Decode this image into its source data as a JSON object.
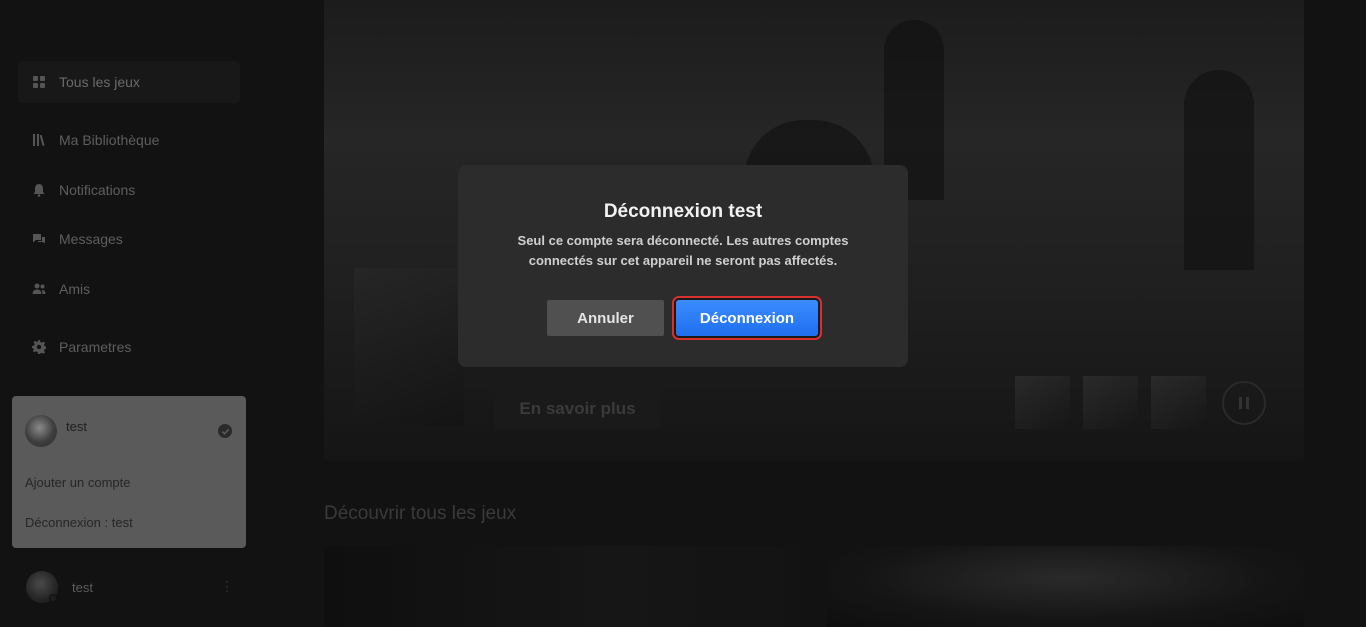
{
  "sidebar": {
    "items": [
      {
        "label": "Tous les jeux",
        "icon": "grid-icon"
      },
      {
        "label": "Ma Bibliothèque",
        "icon": "library-icon"
      },
      {
        "label": "Notifications",
        "icon": "bell-icon"
      },
      {
        "label": "Messages",
        "icon": "chat-icon"
      },
      {
        "label": "Amis",
        "icon": "friends-icon"
      },
      {
        "label": "Parametres",
        "icon": "gear-icon"
      }
    ]
  },
  "account_popup": {
    "username": "test",
    "add_account": "Ajouter un compte",
    "logout": "Déconnexion : test"
  },
  "bottom_user": {
    "username": "test",
    "menu_glyph": "⋮"
  },
  "hero": {
    "learn_more": "En savoir plus"
  },
  "section": {
    "title": "Découvrir tous les jeux"
  },
  "modal": {
    "title": "Déconnexion test",
    "text": "Seul ce compte sera déconnecté. Les autres comptes connectés sur cet appareil ne seront pas affectés.",
    "cancel": "Annuler",
    "confirm": "Déconnexion"
  },
  "colors": {
    "accent": "#2a7dfc",
    "focus_ring": "#d9302c"
  }
}
